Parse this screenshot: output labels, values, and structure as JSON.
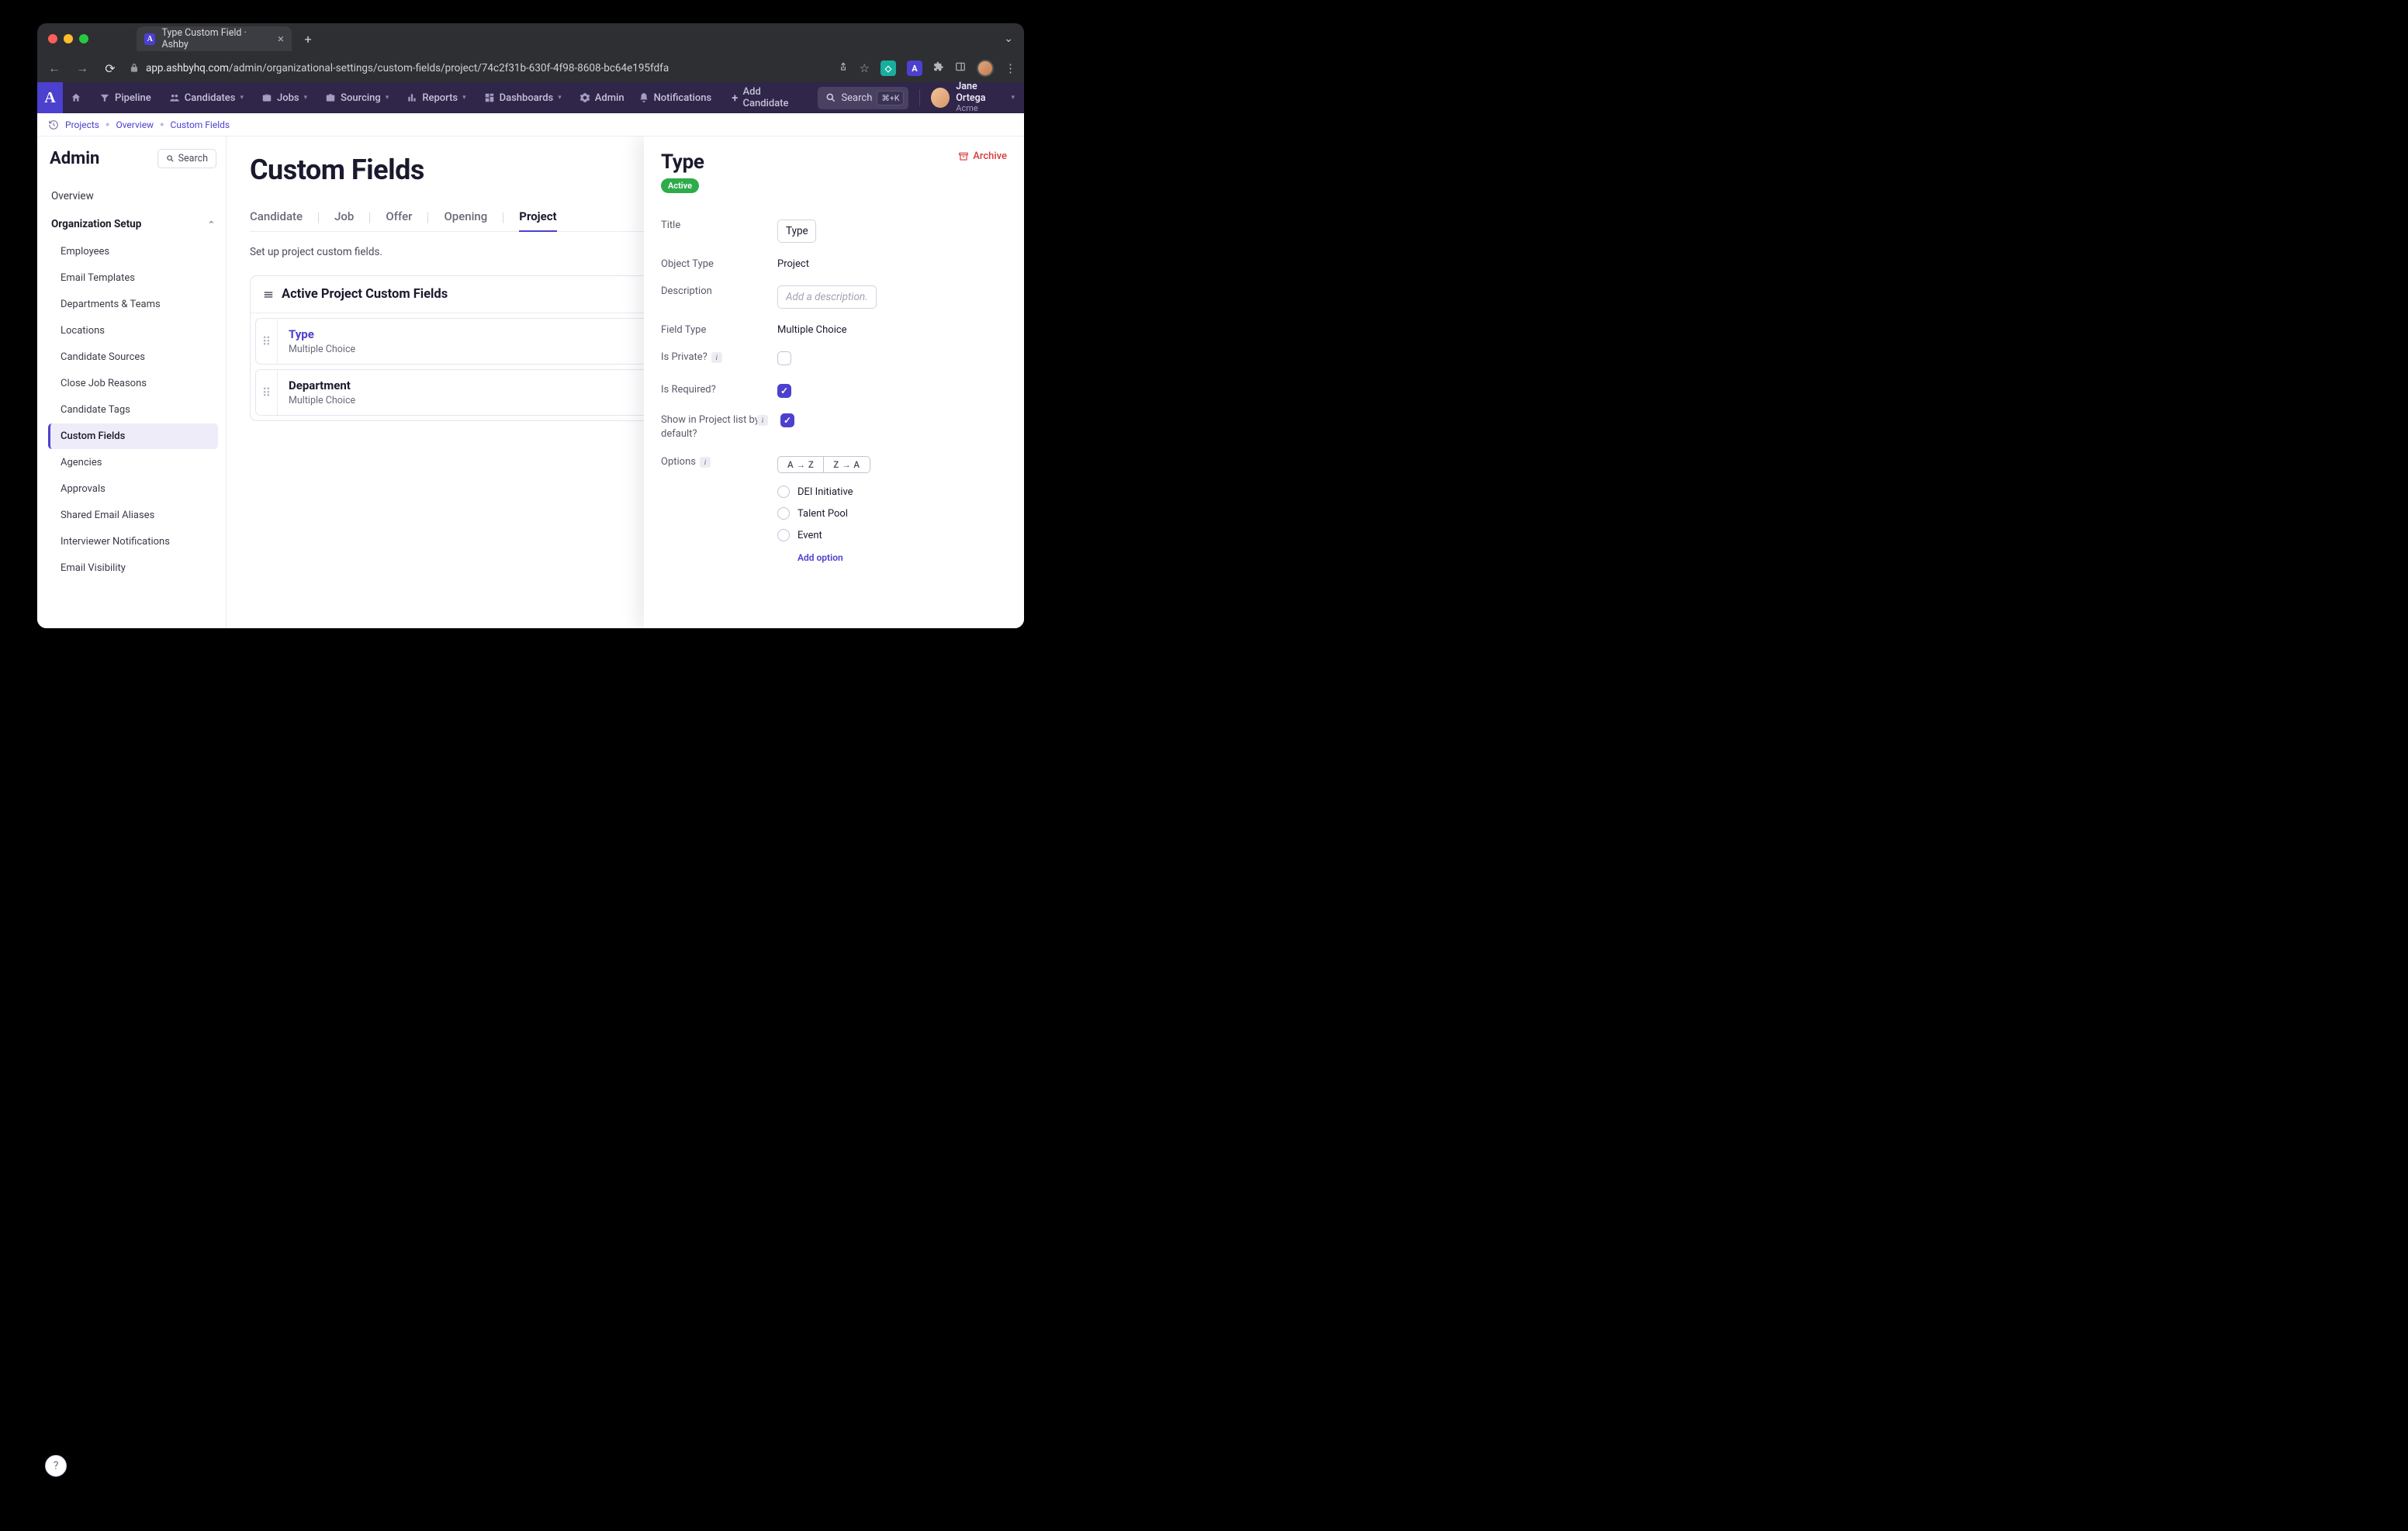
{
  "browser": {
    "tab_title": "Type Custom Field · Ashby",
    "url_domain": "app.ashbyhq.com",
    "url_path": "/admin/organizational-settings/custom-fields/project/74c2f31b-630f-4f98-8608-bc64e195fdfa"
  },
  "top_nav": {
    "items": [
      {
        "label": "Pipeline"
      },
      {
        "label": "Candidates",
        "dd": true
      },
      {
        "label": "Jobs",
        "dd": true
      },
      {
        "label": "Sourcing",
        "dd": true
      },
      {
        "label": "Reports",
        "dd": true
      },
      {
        "label": "Dashboards",
        "dd": true
      },
      {
        "label": "Admin"
      }
    ],
    "notifications": "Notifications",
    "add_candidate": "Add Candidate",
    "search": "Search",
    "search_kbd": "⌘+K",
    "user_name": "Jane Ortega",
    "org": "Acme"
  },
  "breadcrumbs": [
    "Projects",
    "Overview",
    "Custom Fields"
  ],
  "sidebar": {
    "title": "Admin",
    "search": "Search",
    "overview": "Overview",
    "group": "Organization Setup",
    "items": [
      "Employees",
      "Email Templates",
      "Departments & Teams",
      "Locations",
      "Candidate Sources",
      "Close Job Reasons",
      "Candidate Tags",
      "Custom Fields",
      "Agencies",
      "Approvals",
      "Shared Email Aliases",
      "Interviewer Notifications",
      "Email Visibility"
    ],
    "active_idx": 7
  },
  "main": {
    "title": "Custom Fields",
    "tabs": [
      "Candidate",
      "Job",
      "Offer",
      "Opening",
      "Project"
    ],
    "active_tab": 4,
    "desc": "Set up project custom fields.",
    "card_title": "Active Project Custom Fields",
    "rows": [
      {
        "title": "Type",
        "sub": "Multiple Choice",
        "link": true
      },
      {
        "title": "Department",
        "sub": "Multiple Choice",
        "link": false
      }
    ]
  },
  "panel": {
    "title": "Type",
    "archive": "Archive",
    "badge": "Active",
    "labels": {
      "title": "Title",
      "object_type": "Object Type",
      "description": "Description",
      "field_type": "Field Type",
      "is_private": "Is Private?",
      "is_required": "Is Required?",
      "show_in_list": "Show in Project list by default?",
      "options": "Options"
    },
    "values": {
      "title": "Type",
      "object_type": "Project",
      "desc_placeholder": "Add a description...",
      "field_type": "Multiple Choice",
      "is_private": false,
      "is_required": true,
      "show_in_list": true
    },
    "sort": {
      "az": "A → Z",
      "za": "Z → A"
    },
    "options": [
      "DEI Initiative",
      "Talent Pool",
      "Event"
    ],
    "add_option": "Add option"
  }
}
